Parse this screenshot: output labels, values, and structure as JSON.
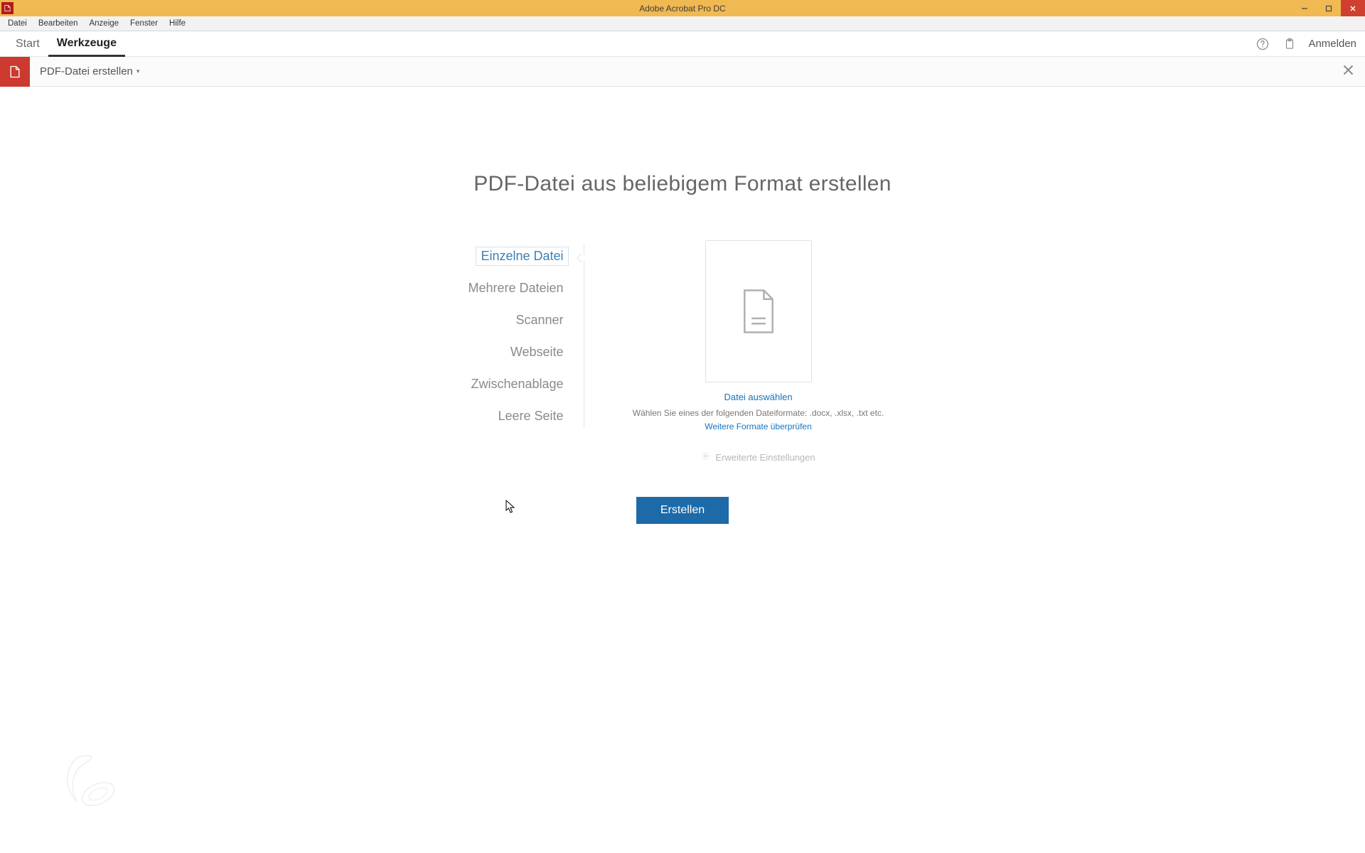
{
  "titlebar": {
    "title": "Adobe Acrobat Pro DC"
  },
  "menubar": {
    "items": [
      "Datei",
      "Bearbeiten",
      "Anzeige",
      "Fenster",
      "Hilfe"
    ]
  },
  "tabs": {
    "items": [
      {
        "label": "Start",
        "active": false
      },
      {
        "label": "Werkzeuge",
        "active": true
      }
    ],
    "signin": "Anmelden"
  },
  "toolbar": {
    "label": "PDF-Datei erstellen"
  },
  "main": {
    "heading": "PDF-Datei aus beliebigem Format erstellen",
    "options": [
      "Einzelne Datei",
      "Mehrere Dateien",
      "Scanner",
      "Webseite",
      "Zwischenablage",
      "Leere Seite"
    ],
    "selected_index": 0,
    "select_file": "Datei auswählen",
    "hint": "Wählen Sie eines der folgenden Dateiformate: .docx, .xlsx, .txt etc.",
    "more_formats": "Weitere Formate überprüfen",
    "advanced": "Erweiterte Einstellungen",
    "create": "Erstellen"
  }
}
